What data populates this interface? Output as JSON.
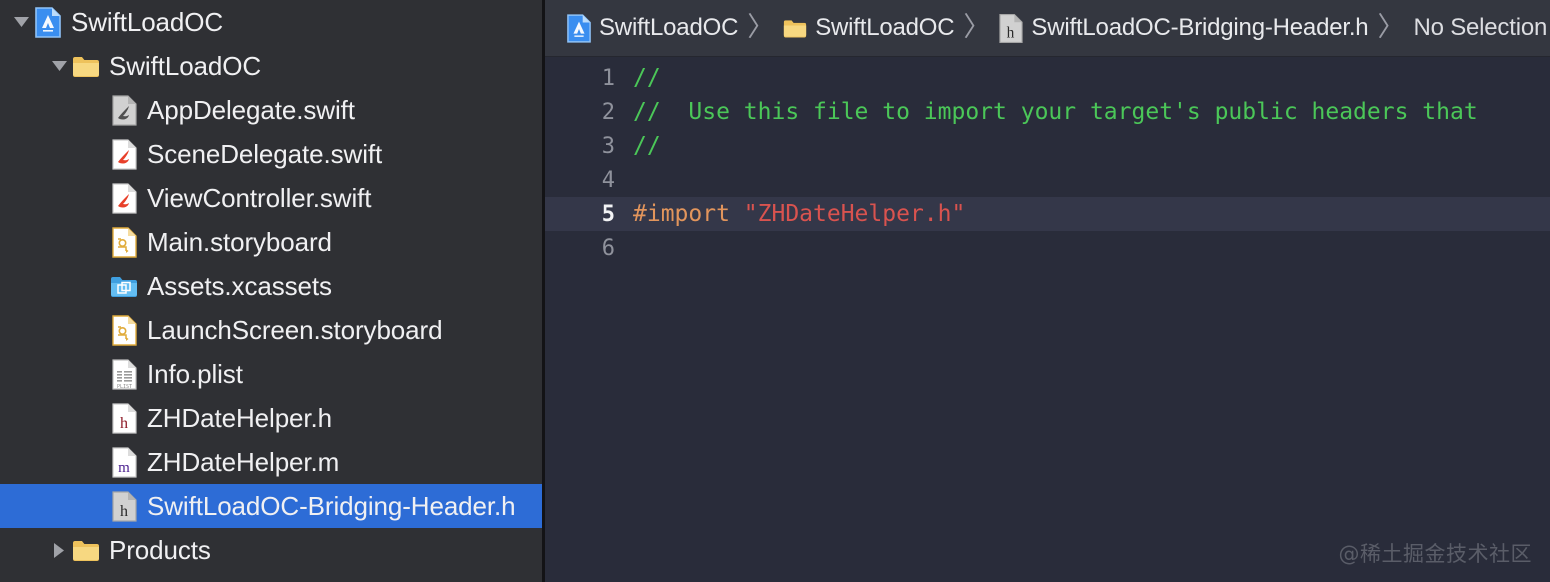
{
  "window": {
    "app": "Xcode",
    "selection_color": "#2d6cd6",
    "sidebar_bg": "#2f3034",
    "editor_bg": "#292c3a",
    "breadcrumb_bg": "#343740",
    "active_line_bg": "#343749"
  },
  "navigator": {
    "name": "project-navigator",
    "rows": [
      {
        "label": "SwiftLoadOC",
        "icon": "xcode-project-icon",
        "indent": 0,
        "twisty": "down",
        "selected": false,
        "dimmed": false
      },
      {
        "label": "SwiftLoadOC",
        "icon": "folder-yellow-icon",
        "indent": 1,
        "twisty": "down",
        "selected": false,
        "dimmed": false
      },
      {
        "label": "AppDelegate.swift",
        "icon": "swift-file-icon",
        "indent": 2,
        "twisty": "none",
        "selected": false,
        "dimmed": true
      },
      {
        "label": "SceneDelegate.swift",
        "icon": "swift-file-icon",
        "indent": 2,
        "twisty": "none",
        "selected": false,
        "dimmed": false
      },
      {
        "label": "ViewController.swift",
        "icon": "swift-file-icon",
        "indent": 2,
        "twisty": "none",
        "selected": false,
        "dimmed": false
      },
      {
        "label": "Main.storyboard",
        "icon": "storyboard-file-icon",
        "indent": 2,
        "twisty": "none",
        "selected": false,
        "dimmed": false
      },
      {
        "label": "Assets.xcassets",
        "icon": "xcassets-folder-icon",
        "indent": 2,
        "twisty": "none",
        "selected": false,
        "dimmed": false
      },
      {
        "label": "LaunchScreen.storyboard",
        "icon": "storyboard-file-icon",
        "indent": 2,
        "twisty": "none",
        "selected": false,
        "dimmed": false
      },
      {
        "label": "Info.plist",
        "icon": "plist-file-icon",
        "indent": 2,
        "twisty": "none",
        "selected": false,
        "dimmed": false
      },
      {
        "label": "ZHDateHelper.h",
        "icon": "header-file-icon",
        "indent": 2,
        "twisty": "none",
        "selected": false,
        "dimmed": false
      },
      {
        "label": "ZHDateHelper.m",
        "icon": "objc-file-icon",
        "indent": 2,
        "twisty": "none",
        "selected": false,
        "dimmed": false
      },
      {
        "label": "SwiftLoadOC-Bridging-Header.h",
        "icon": "header-file-icon",
        "indent": 2,
        "twisty": "none",
        "selected": true,
        "dimmed": true
      },
      {
        "label": "Products",
        "icon": "folder-yellow-icon",
        "indent": 1,
        "twisty": "right",
        "selected": false,
        "dimmed": false
      }
    ]
  },
  "breadcrumb": {
    "separator": "〉",
    "items": [
      {
        "label": "SwiftLoadOC",
        "icon": "xcode-project-icon"
      },
      {
        "label": "SwiftLoadOC",
        "icon": "folder-yellow-icon"
      },
      {
        "label": "SwiftLoadOC-Bridging-Header.h",
        "icon": "header-file-icon"
      },
      {
        "label": "No Selection",
        "icon": "none"
      }
    ]
  },
  "editor": {
    "name": "source-editor",
    "active_line": 5,
    "lines": [
      {
        "number": "1",
        "tokens": [
          {
            "text": "//",
            "cls": "tok-comment"
          }
        ]
      },
      {
        "number": "2",
        "tokens": [
          {
            "text": "//  Use this file to import your target's public headers that",
            "cls": "tok-comment"
          }
        ]
      },
      {
        "number": "3",
        "tokens": [
          {
            "text": "//",
            "cls": "tok-comment"
          }
        ]
      },
      {
        "number": "4",
        "tokens": []
      },
      {
        "number": "5",
        "tokens": [
          {
            "text": "#import ",
            "cls": "tok-pre"
          },
          {
            "text": "\"ZHDateHelper.h\"",
            "cls": "tok-string"
          }
        ]
      },
      {
        "number": "6",
        "tokens": []
      }
    ]
  },
  "watermark": {
    "text": "@稀土掘金技术社区"
  }
}
